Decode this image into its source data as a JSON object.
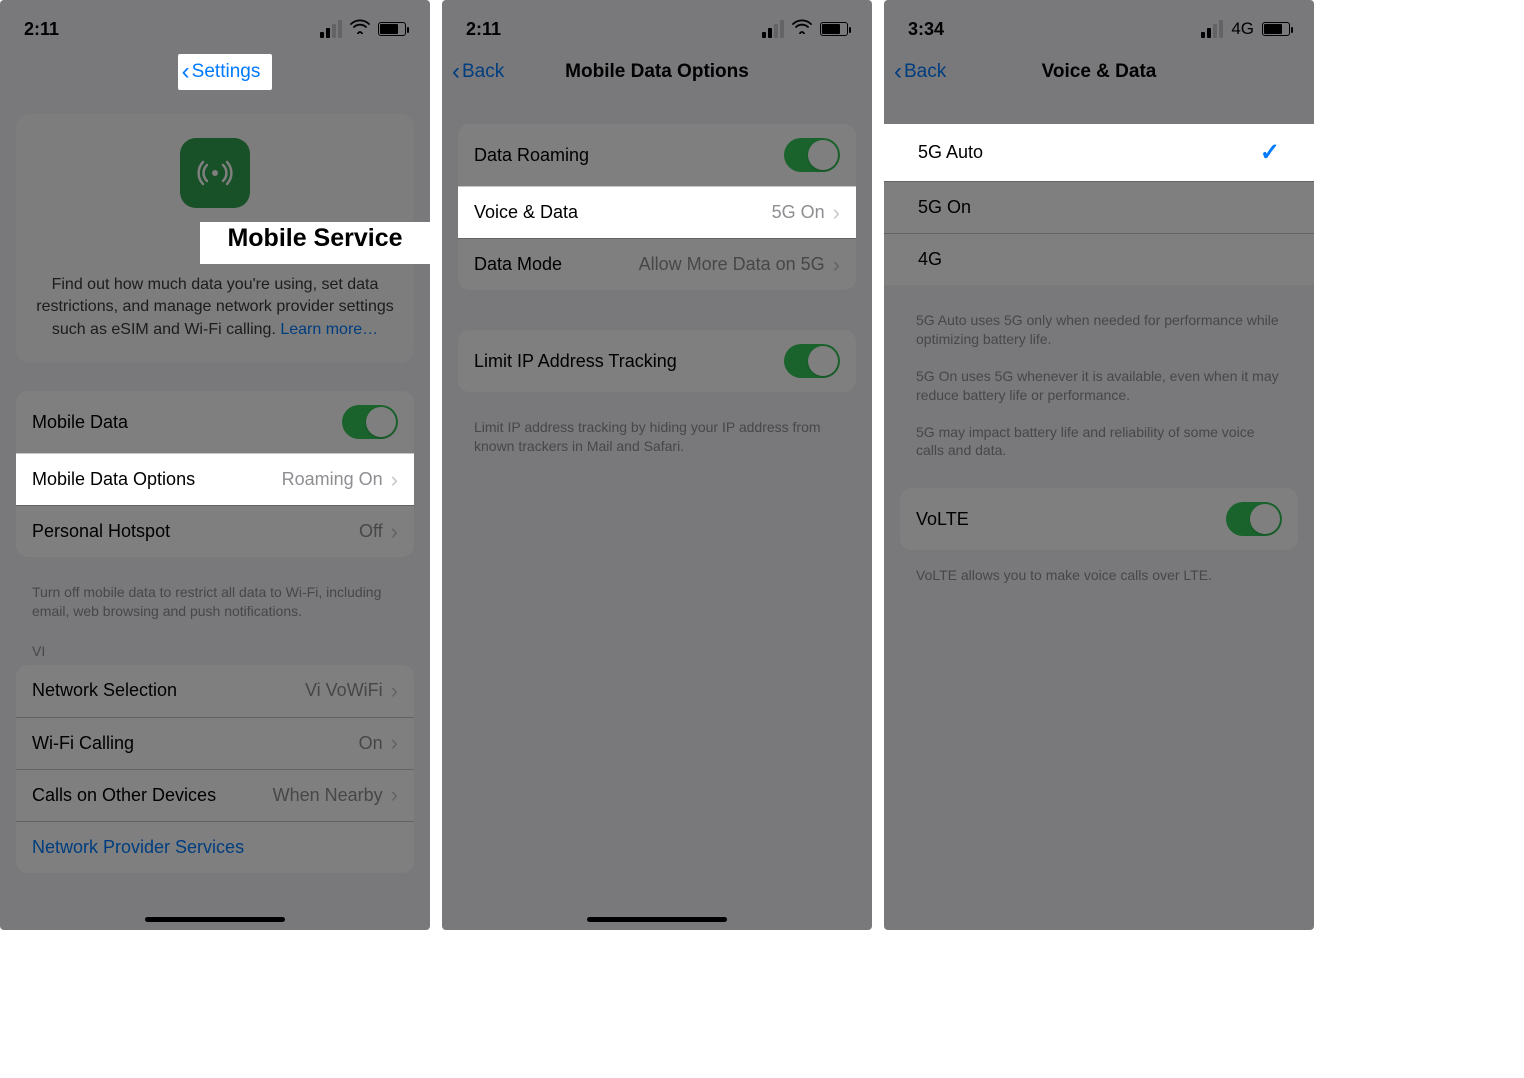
{
  "panels": [
    {
      "status": {
        "time": "2:11",
        "net_type": "wifi"
      },
      "nav": {
        "back_label": "Settings",
        "title": ""
      },
      "hero": {
        "title": "Mobile Service",
        "desc": "Find out how much data you're using, set data restrictions, and manage network provider settings such as eSIM and Wi-Fi calling. ",
        "link": "Learn more…"
      },
      "group1": {
        "mobile_data": {
          "label": "Mobile Data"
        },
        "mobile_data_options": {
          "label": "Mobile Data Options",
          "value": "Roaming On"
        },
        "personal_hotspot": {
          "label": "Personal Hotspot",
          "value": "Off"
        }
      },
      "footer1": "Turn off mobile data to restrict all data to Wi-Fi, including email, web browsing and push notifications.",
      "section_header": "VI",
      "group2": {
        "network_selection": {
          "label": "Network Selection",
          "value": "Vi VoWiFi"
        },
        "wifi_calling": {
          "label": "Wi-Fi Calling",
          "value": "On"
        },
        "calls_other": {
          "label": "Calls on Other Devices",
          "value": "When Nearby"
        },
        "network_provider": {
          "label": "Network Provider Services"
        }
      }
    },
    {
      "status": {
        "time": "2:11",
        "net_type": "wifi"
      },
      "nav": {
        "back_label": "Back",
        "title": "Mobile Data Options"
      },
      "group1": {
        "data_roaming": {
          "label": "Data Roaming"
        },
        "voice_data": {
          "label": "Voice & Data",
          "value": "5G On"
        },
        "data_mode": {
          "label": "Data Mode",
          "value": "Allow More Data on 5G"
        }
      },
      "group2": {
        "limit_ip": {
          "label": "Limit IP Address Tracking"
        }
      },
      "footer1": "Limit IP address tracking by hiding your IP address from known trackers in Mail and Safari."
    },
    {
      "status": {
        "time": "3:34",
        "net_type": "4G"
      },
      "nav": {
        "back_label": "Back",
        "title": "Voice & Data"
      },
      "options": [
        {
          "label": "5G Auto",
          "selected": true
        },
        {
          "label": "5G On",
          "selected": false
        },
        {
          "label": "4G",
          "selected": false
        }
      ],
      "explain": [
        "5G Auto uses 5G only when needed for performance while optimizing battery life.",
        "5G On uses 5G whenever it is available, even when it may reduce battery life or performance.",
        "5G may impact battery life and reliability of some voice calls and data."
      ],
      "volte": {
        "label": "VoLTE"
      },
      "volte_footer": "VoLTE allows you to make voice calls over LTE."
    }
  ]
}
